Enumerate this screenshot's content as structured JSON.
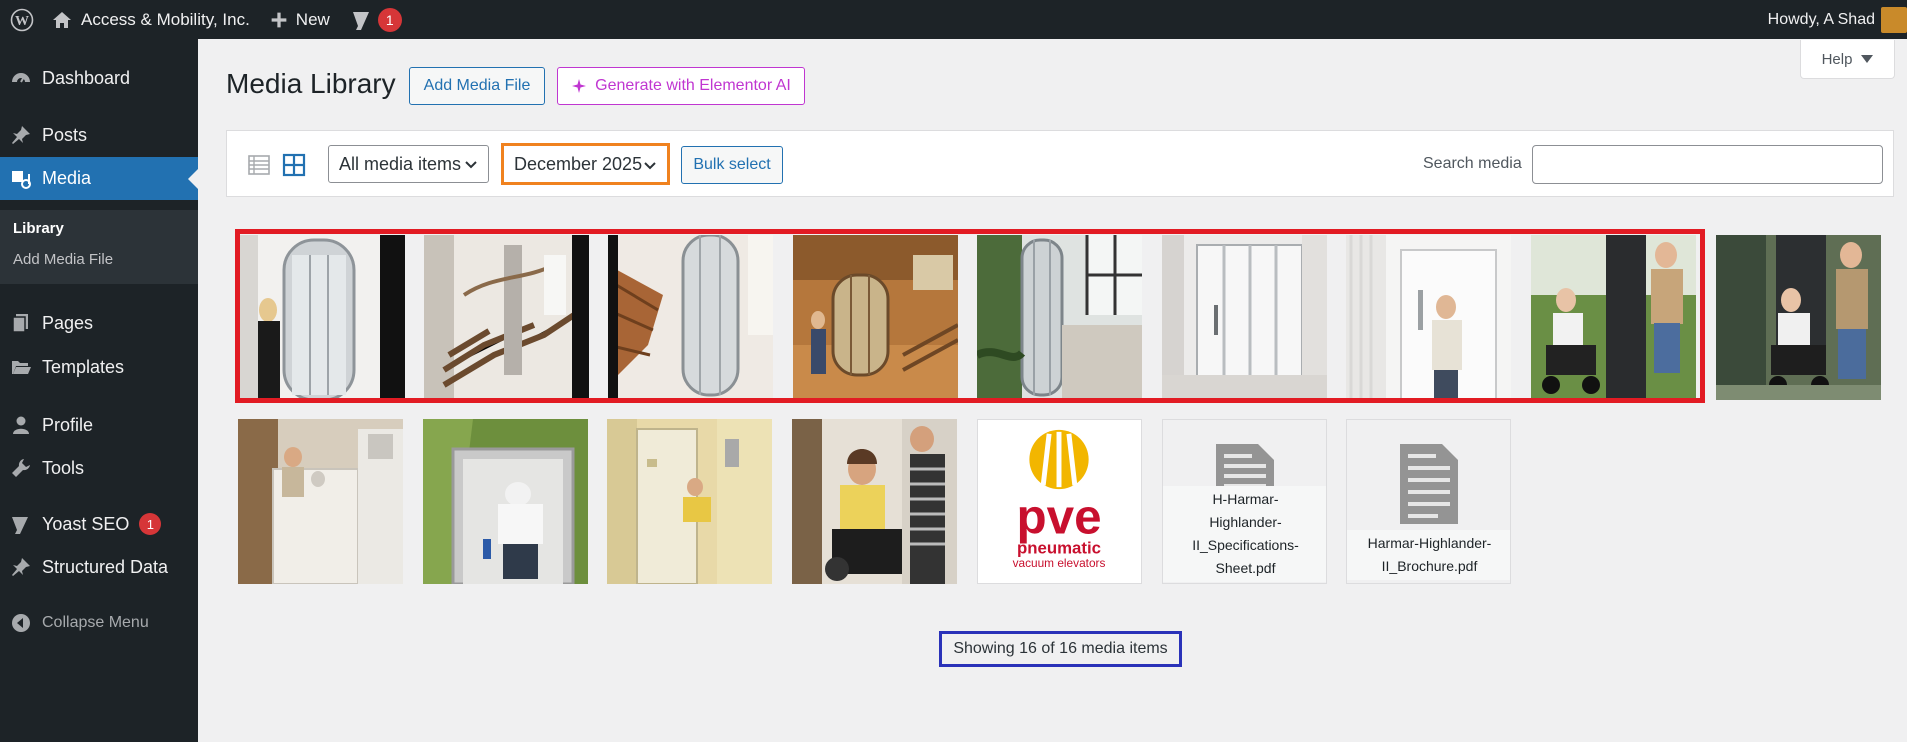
{
  "admin_bar": {
    "site_name": "Access & Mobility, Inc.",
    "new_label": "New",
    "yoast_count": "1",
    "greeting": "Howdy, A Shad"
  },
  "sidebar": {
    "dashboard": "Dashboard",
    "posts": "Posts",
    "media": "Media",
    "library": "Library",
    "add_media_file": "Add Media File",
    "pages": "Pages",
    "templates": "Templates",
    "profile": "Profile",
    "tools": "Tools",
    "yoast": "Yoast SEO",
    "yoast_count": "1",
    "structured_data": "Structured Data",
    "collapse": "Collapse Menu"
  },
  "header": {
    "title": "Media Library",
    "add_media_button": "Add Media File",
    "ai_button": "Generate with Elementor AI",
    "help": "Help"
  },
  "toolbar": {
    "filter_type": "All media items",
    "filter_date": "December 2025",
    "bulk_select": "Bulk select",
    "search_label": "Search media",
    "search_value": ""
  },
  "media": {
    "files": [
      {
        "name": "H-Harmar-Highlander-II_Specifications-Sheet.pdf",
        "lines": [
          "H-Harmar-",
          "Highlander-",
          "II_Specifications-",
          "Sheet.pdf"
        ]
      },
      {
        "name": "Harmar-Highlander-II_Brochure.pdf",
        "lines": [
          "Harmar-Highlander-",
          "II_Brochure.pdf"
        ]
      }
    ],
    "logo": {
      "brand": "pve",
      "line1": "pneumatic",
      "line2": "vacuum elevators"
    }
  },
  "footer": {
    "count_text": "Showing 16 of 16 media items"
  },
  "colors": {
    "admin_dark": "#1d2327",
    "accent_blue": "#2271b1",
    "ai_magenta": "#c036d1",
    "highlight_red": "#e21b23",
    "highlight_orange": "#f0821f",
    "highlight_navy": "#2a32b9"
  }
}
